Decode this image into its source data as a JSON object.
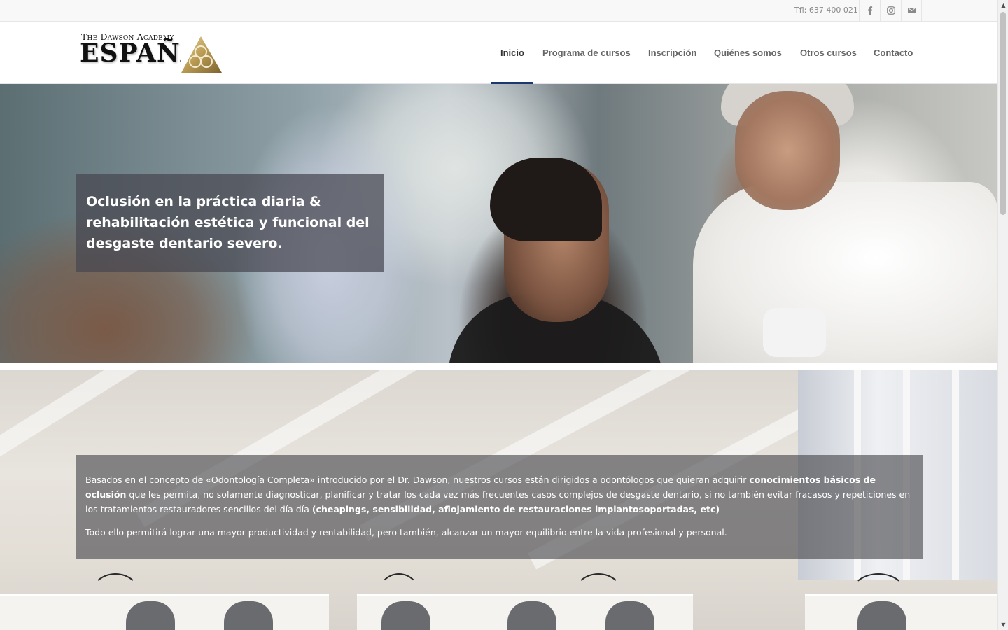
{
  "topbar": {
    "phone": "Tfl: 637 400 021",
    "social": [
      {
        "name": "facebook-icon"
      },
      {
        "name": "instagram-icon"
      },
      {
        "name": "mail-icon"
      }
    ]
  },
  "logo": {
    "line1": "The Dawson Academy",
    "line2": "España"
  },
  "nav": {
    "items": [
      {
        "label": "Inicio",
        "active": true
      },
      {
        "label": "Programa de cursos"
      },
      {
        "label": "Inscripción"
      },
      {
        "label": "Quiénes somos"
      },
      {
        "label": "Otros cursos"
      },
      {
        "label": "Contacto"
      }
    ],
    "active_color": "#1a3a6e"
  },
  "hero": {
    "title": "Oclusión en la práctica diaria & rehabilitación estética y funcional del desgaste dentario severo."
  },
  "intro": {
    "p1_a": "Basados en el concepto de «Odontología Completa» introducido por el Dr. Dawson, nuestros cursos están dirigidos a odontólogos que quieran adquirir ",
    "p1_b": "conocimientos básicos de oclusión",
    "p1_c": " que les permita, no solamente diagnosticar, planificar y tratar los cada vez más frecuentes casos complejos de desgaste dentario, si no también evitar fracasos y repeticiones en los tratamientos restauradores sencillos del día día ",
    "p1_d": "(cheapings, sensibilidad, aflojamiento de restauraciones implantosoportadas, etc)",
    "p2": "Todo ello permitirá lograr una mayor productividad y rentabilidad, pero también, alcanzar un mayor equilibrio entre la vida profesional y personal."
  }
}
